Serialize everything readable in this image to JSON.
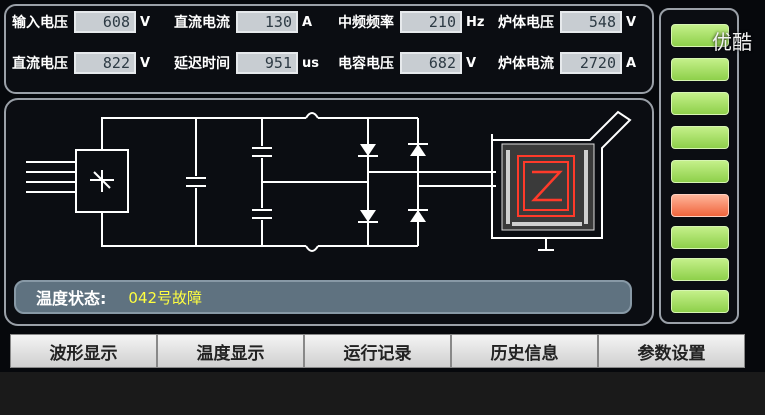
{
  "readings": [
    {
      "label": "输入电压",
      "value": "608",
      "unit": "V"
    },
    {
      "label": "直流电流",
      "value": "130",
      "unit": "A"
    },
    {
      "label": "中频频率",
      "value": "210",
      "unit": "Hz"
    },
    {
      "label": "炉体电压",
      "value": "548",
      "unit": "V"
    },
    {
      "label": "直流电压",
      "value": "822",
      "unit": "V"
    },
    {
      "label": "延迟时间",
      "value": "951",
      "unit": "us"
    },
    {
      "label": "电容电压",
      "value": "682",
      "unit": "V"
    },
    {
      "label": "炉体电流",
      "value": "2720",
      "unit": "A"
    }
  ],
  "status": {
    "label": "温度状态:",
    "value": "042号故障"
  },
  "nav": [
    "波形显示",
    "温度显示",
    "运行记录",
    "历史信息",
    "参数设置"
  ],
  "watermark": "优酷",
  "colors": {
    "ok_button": "#a6e060",
    "alarm_button": "#f0643c",
    "status_text": "#ffff40"
  }
}
